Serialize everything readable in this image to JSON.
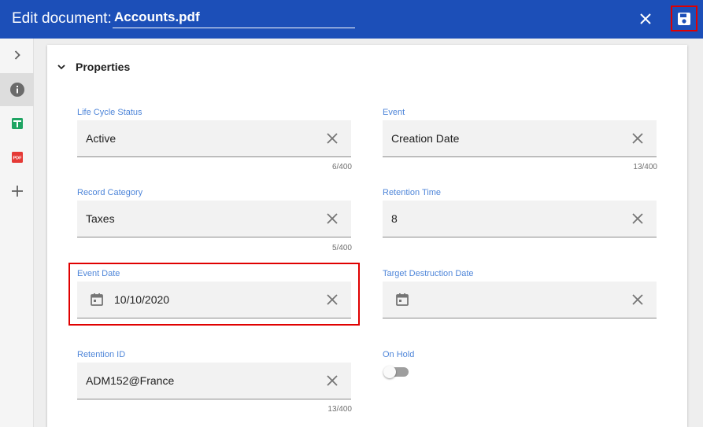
{
  "header": {
    "title_label": "Edit document:",
    "document_name": "Accounts.pdf"
  },
  "sidebar": {
    "items": [
      {
        "icon": "chevron-right-icon"
      },
      {
        "icon": "info-icon"
      },
      {
        "icon": "spreadsheet-icon"
      },
      {
        "icon": "pdf-icon",
        "badge": "PDF"
      },
      {
        "icon": "plus-icon"
      }
    ]
  },
  "properties": {
    "section_title": "Properties",
    "fields": {
      "lifecycle_status": {
        "label": "Life Cycle Status",
        "value": "Active",
        "counter": "6/400"
      },
      "event": {
        "label": "Event",
        "value": "Creation Date",
        "counter": "13/400"
      },
      "record_category": {
        "label": "Record Category",
        "value": "Taxes",
        "counter": "5/400"
      },
      "retention_time": {
        "label": "Retention Time",
        "value": "8"
      },
      "event_date": {
        "label": "Event Date",
        "value": "10/10/2020"
      },
      "target_destruction_date": {
        "label": "Target Destruction Date",
        "value": ""
      },
      "retention_id": {
        "label": "Retention ID",
        "value": "ADM152@France",
        "counter": "13/400"
      },
      "on_hold": {
        "label": "On Hold",
        "checked": false
      }
    }
  },
  "colors": {
    "header_bg": "#1c4fb8",
    "label_blue": "#4f86d9",
    "highlight_red": "#e00000"
  }
}
